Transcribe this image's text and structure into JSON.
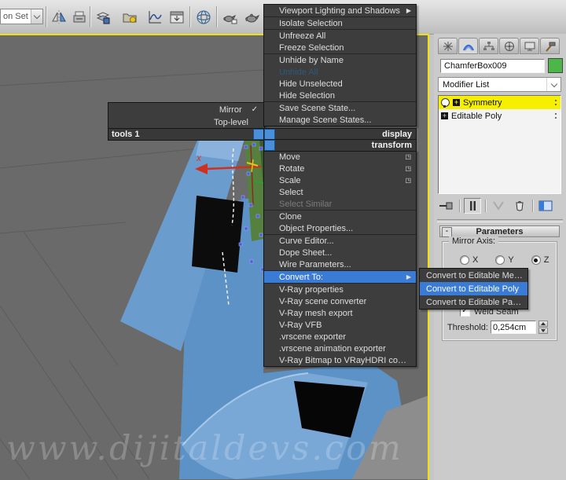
{
  "toolbar": {
    "selection_set_value": "on Set"
  },
  "viewport": {
    "axis_label": "x",
    "watermark": "www.dijitaldevs.com"
  },
  "quad_menu": {
    "satellite_items": [
      {
        "label": "Mirror",
        "right": "✓"
      },
      {
        "label": "Top-level"
      }
    ],
    "tools_header": "tools 1",
    "display_header": "display",
    "transform_header": "transform",
    "display_items": [
      {
        "label": "Viewport Lighting and Shadows",
        "right": "▶",
        "cls": "sep-after"
      },
      {
        "label": "Isolate Selection",
        "cls": "sep-after"
      },
      {
        "label": "Unfreeze All"
      },
      {
        "label": "Freeze Selection",
        "cls": "sep-after"
      },
      {
        "label": "Unhide by Name"
      },
      {
        "label": "Unhide All",
        "cls": "dim"
      },
      {
        "label": "Hide Unselected"
      },
      {
        "label": "Hide Selection",
        "cls": "sep-after"
      },
      {
        "label": "Save Scene State..."
      },
      {
        "label": "Manage Scene States..."
      }
    ],
    "transform_items": [
      {
        "label": "Move",
        "right": "◳"
      },
      {
        "label": "Rotate",
        "right": "◳"
      },
      {
        "label": "Scale",
        "right": "◳"
      },
      {
        "label": "Select"
      },
      {
        "label": "Select Similar",
        "cls": "disabled sep-after"
      },
      {
        "label": "Clone"
      },
      {
        "label": "Object Properties...",
        "cls": "sep-after"
      },
      {
        "label": "Curve Editor..."
      },
      {
        "label": "Dope Sheet..."
      },
      {
        "label": "Wire Parameters...",
        "cls": "sep-after"
      },
      {
        "label": "Convert To:",
        "right": "▶",
        "cls": "highlight sep-after"
      },
      {
        "label": "V-Ray properties"
      },
      {
        "label": "V-Ray scene converter"
      },
      {
        "label": "V-Ray mesh export"
      },
      {
        "label": "V-Ray VFB"
      },
      {
        "label": ".vrscene exporter"
      },
      {
        "label": ".vrscene animation exporter"
      },
      {
        "label": "V-Ray Bitmap to VRayHDRI converter"
      }
    ],
    "convert_submenu_items": [
      {
        "label": "Convert to Editable Mesh"
      },
      {
        "label": "Convert to Editable Poly",
        "cls": "highlight"
      },
      {
        "label": "Convert to Editable Patch"
      }
    ]
  },
  "command_panel": {
    "object_name": "ChamferBox009",
    "modifier_list_label": "Modifier List",
    "modifier_stack": [
      {
        "label": "Symmetry",
        "plus": "+"
      },
      {
        "label": "Editable Poly",
        "plus": "+"
      }
    ],
    "parameters": {
      "rollout_title": "Parameters",
      "collapse_glyph": "-",
      "mirror_axis_label": "Mirror Axis:",
      "axis_options": [
        {
          "label": "X"
        },
        {
          "label": "Y"
        },
        {
          "label": "Z",
          "cls": "selected"
        }
      ],
      "weld_seam_label": "Weld Seam",
      "weld_seam_check": "✓",
      "threshold_label": "Threshold:",
      "threshold_value": "0,254cm"
    }
  },
  "colors": {
    "selection_highlight": "#3a7bd5",
    "stack_selected_yellow": "#f6ef00",
    "object_color_swatch": "#4cb748",
    "viewport_border_yellow": "#f0e010"
  }
}
